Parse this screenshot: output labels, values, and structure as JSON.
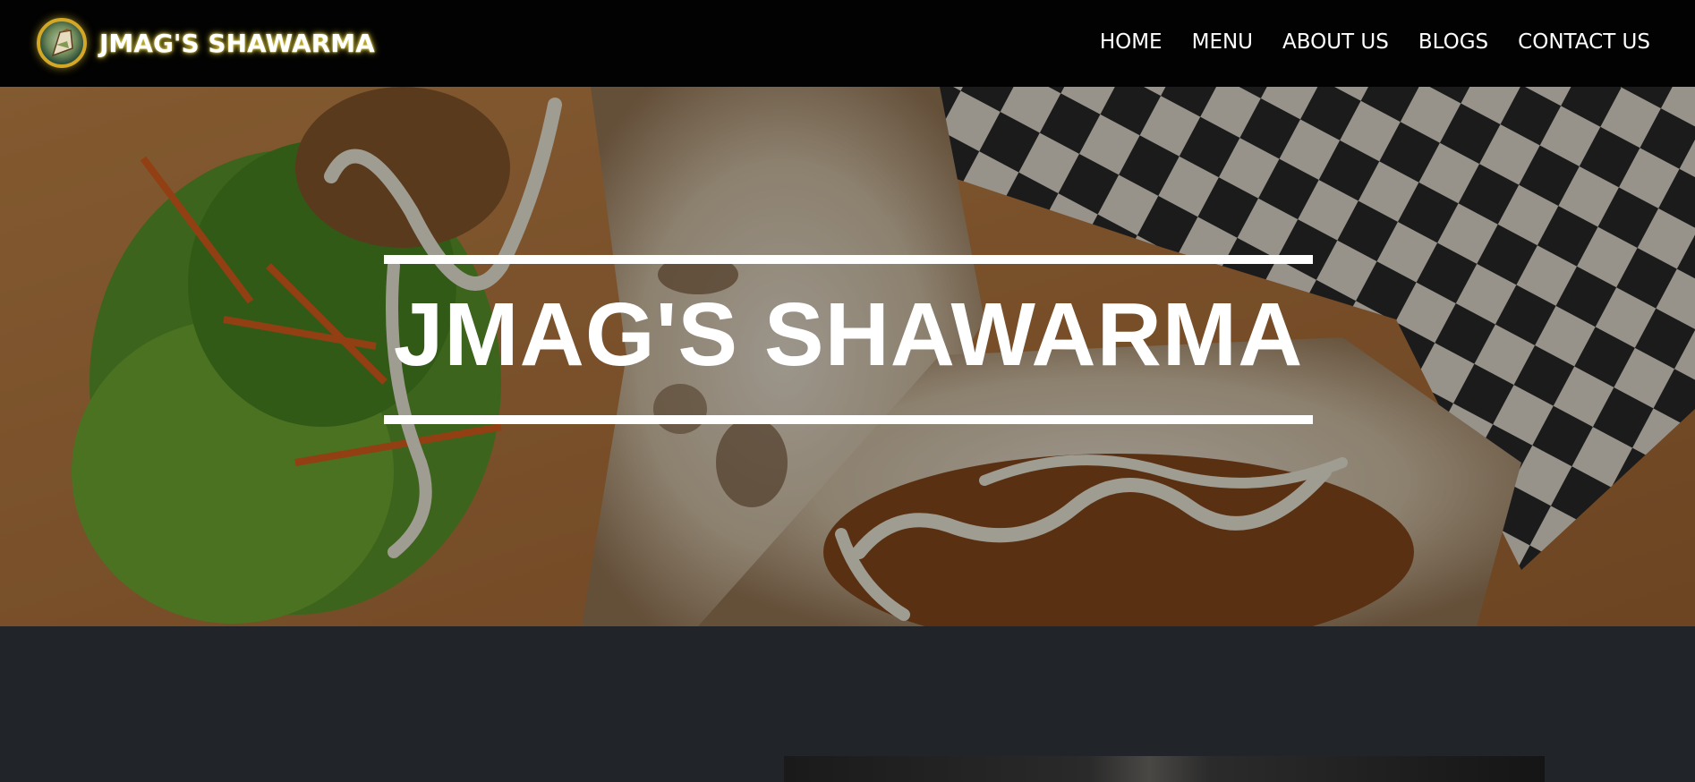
{
  "navbar": {
    "brand_name": "JMAG'S SHAWARMA",
    "brand_logo_icon": "shawarma-logo-icon",
    "links": [
      "HOME",
      "MENU",
      "ABOUT US",
      "BLOGS",
      "CONTACT US"
    ]
  },
  "hero": {
    "title": "JMAG'S SHAWARMA"
  },
  "colors": {
    "navbar_bg": "#020202",
    "page_bg": "#212529",
    "text": "#ffffff",
    "brand_glow": "#f0dc3c"
  }
}
